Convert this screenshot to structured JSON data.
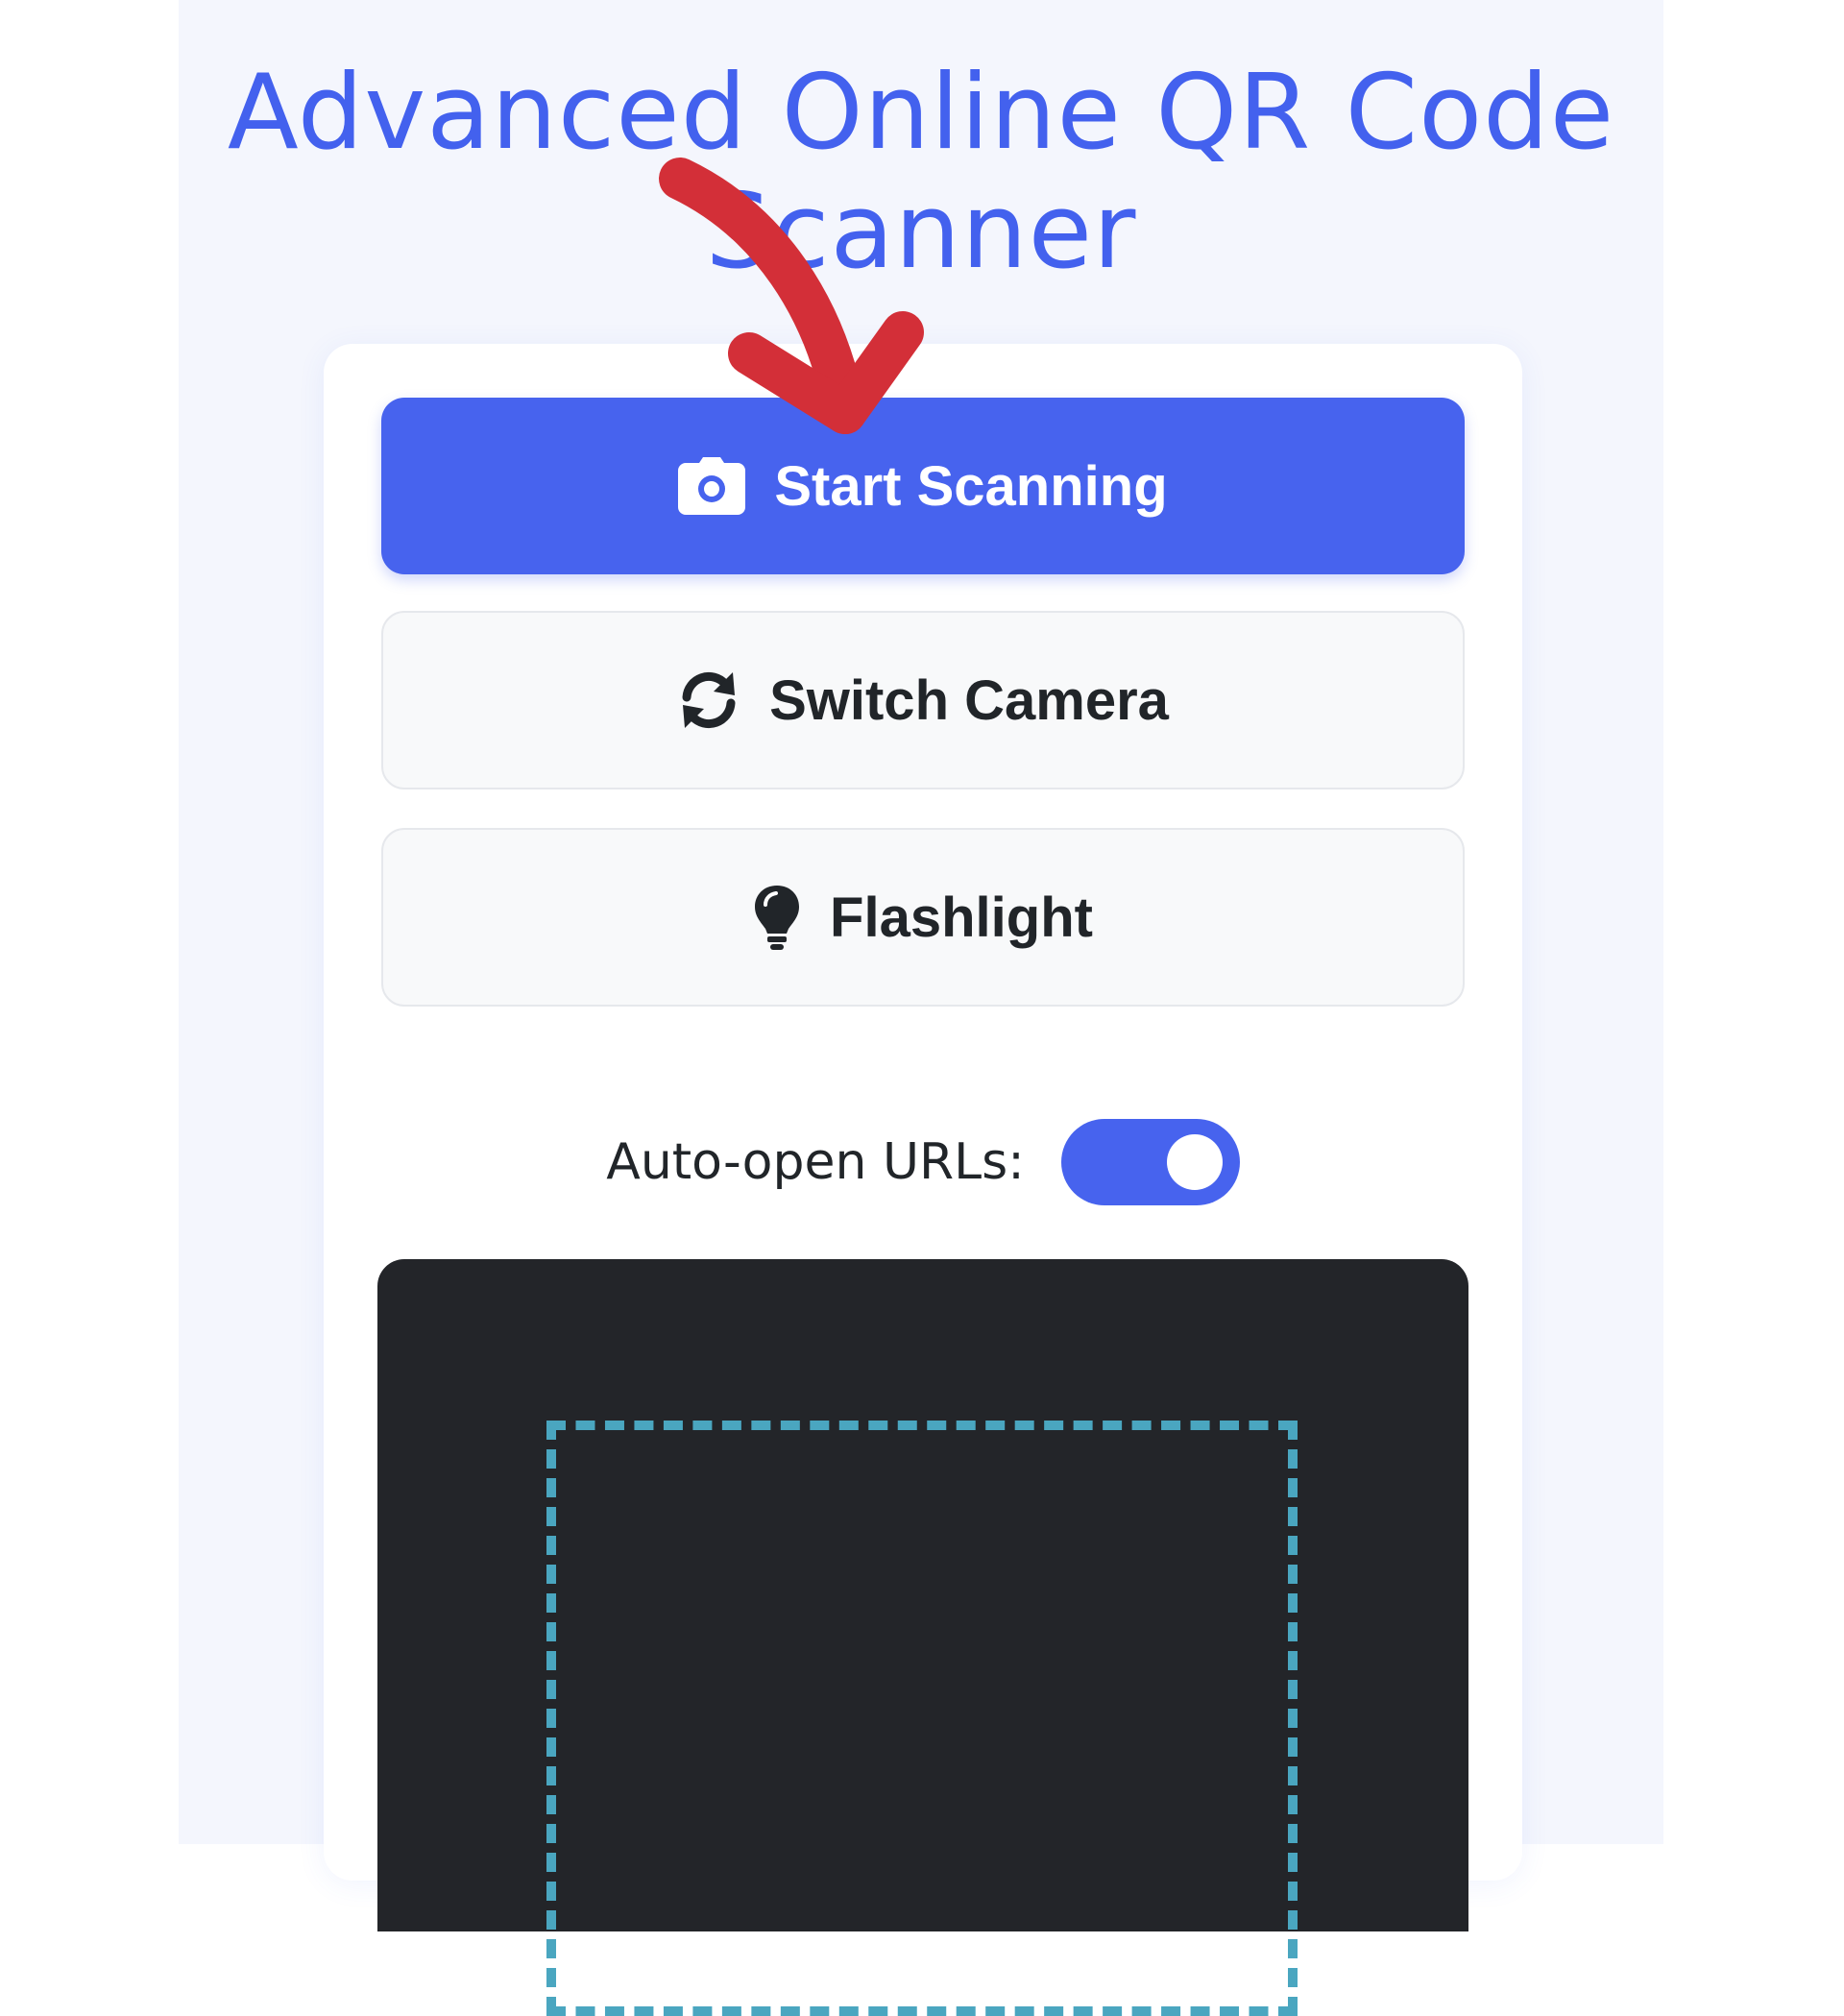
{
  "header": {
    "title": "Advanced Online QR Code Scanner"
  },
  "controls": {
    "start_label": "Start Scanning",
    "start_icon": "camera-icon",
    "switch_label": "Switch Camera",
    "switch_icon": "sync-icon",
    "flash_label": "Flashlight",
    "flash_icon": "lightbulb-icon"
  },
  "settings": {
    "auto_open_label": "Auto-open URLs:",
    "auto_open_enabled": true
  },
  "colors": {
    "accent": "#4763ee",
    "title": "#4361ee",
    "annotation_arrow": "#d32f38",
    "scan_frame": "#4aa6c0",
    "scanner_bg": "#232529"
  }
}
